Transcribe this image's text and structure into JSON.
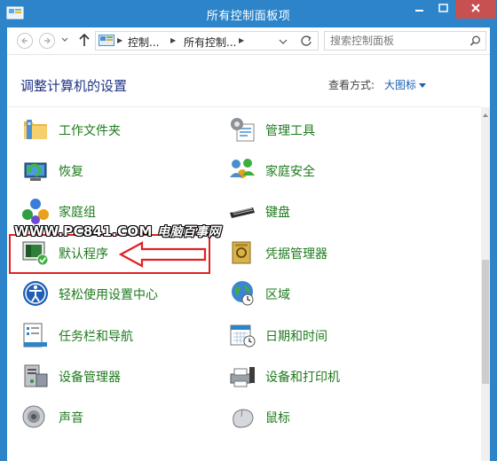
{
  "window": {
    "title": "所有控制面板项"
  },
  "address": {
    "crumbs": [
      "控制...",
      "所有控制..."
    ],
    "search_placeholder": "搜索控制面板"
  },
  "header": {
    "heading": "调整计算机的设置",
    "view_by_label": "查看方式:",
    "view_by_value": "大图标"
  },
  "items": {
    "left": [
      {
        "label": "工作文件夹",
        "icon": "work-folders-icon"
      },
      {
        "label": "恢复",
        "icon": "recovery-icon"
      },
      {
        "label": "家庭组",
        "icon": "homegroup-icon"
      },
      {
        "label": "默认程序",
        "icon": "default-programs-icon"
      },
      {
        "label": "轻松使用设置中心",
        "icon": "ease-of-access-icon"
      },
      {
        "label": "任务栏和导航",
        "icon": "taskbar-icon"
      },
      {
        "label": "设备管理器",
        "icon": "device-manager-icon"
      },
      {
        "label": "声音",
        "icon": "sound-icon"
      }
    ],
    "right": [
      {
        "label": "管理工具",
        "icon": "admin-tools-icon"
      },
      {
        "label": "家庭安全",
        "icon": "family-safety-icon"
      },
      {
        "label": "键盘",
        "icon": "keyboard-icon"
      },
      {
        "label": "凭据管理器",
        "icon": "credential-manager-icon"
      },
      {
        "label": "区域",
        "icon": "region-icon"
      },
      {
        "label": "日期和时间",
        "icon": "date-time-icon"
      },
      {
        "label": "设备和打印机",
        "icon": "devices-printers-icon"
      },
      {
        "label": "鼠标",
        "icon": "mouse-icon"
      }
    ]
  },
  "watermark": {
    "site": "WWW.PC841.COM",
    "cn": "电脑百事网"
  },
  "colors": {
    "titlebar": "#2d84c8",
    "heading": "#1e3287",
    "item_label": "#1d7a1d",
    "link": "#1a5fb4",
    "highlight": "#e02020"
  }
}
